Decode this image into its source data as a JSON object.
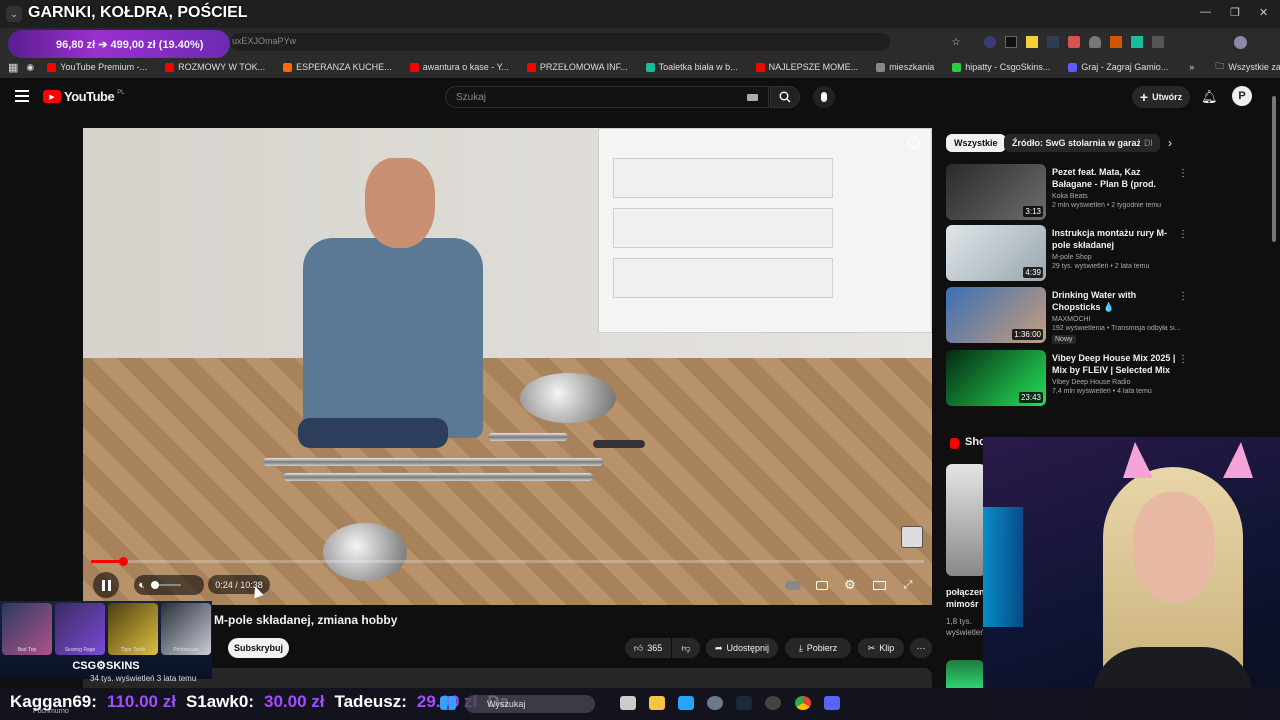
{
  "stream_overlay": {
    "title": "GARNKI, KOŁDRA, POŚCIEL",
    "price_text": "96,80 zł ➔ 499,00 zł (19.40%)",
    "url_fragment": "uxEXJOmaPYw"
  },
  "bookmarks": [
    {
      "label": "YouTube Premium -...",
      "color": "#ff0000"
    },
    {
      "label": "ROZMOWY W TOK...",
      "color": "#ff0000"
    },
    {
      "label": "ESPERANZA KUCHE...",
      "color": "#ff6a00"
    },
    {
      "label": "awantura o kase - Y...",
      "color": "#ff0000"
    },
    {
      "label": "PRZEŁOMOWA INF...",
      "color": "#ff0000"
    },
    {
      "label": "Toaletka biała w b...",
      "color": "#1abc9c"
    },
    {
      "label": "NAJLEPSZE MOME...",
      "color": "#ff0000"
    },
    {
      "label": "mieszkania",
      "color": "#888888"
    },
    {
      "label": "hipatty - CsgoSkins...",
      "color": "#2ecc40"
    },
    {
      "label": "Graj - Zagraj Gamio...",
      "color": "#5b5bff"
    }
  ],
  "bookmarks_all": "Wszystkie zakładki",
  "youtube": {
    "logo": "YouTube",
    "logo_country": "PL",
    "search_placeholder": "Szukaj",
    "create_label": "Utwórz"
  },
  "player": {
    "current_time": "0:24",
    "duration": "10:38",
    "time_display": "0:24 / 10:38",
    "progress": 0.038
  },
  "video": {
    "title": "M-pole składanej, zmiana hobby",
    "subscribe": "Subskrybuj",
    "likes": "365",
    "share": "Udostępnij",
    "download": "Pobierz",
    "clip": "Klip",
    "description_meta": "34 tys. wyświetleń  3 lata temu"
  },
  "chips": [
    {
      "label": "Wszystkie",
      "active": true
    },
    {
      "label": "Źródło: SwG stolarnia w garażu",
      "active": false
    },
    {
      "label": "Dl",
      "active": false
    }
  ],
  "recommendations": [
    {
      "title": "Pezet feat. Mata, Kaz Bałagane - Plan B (prod. Pedro, Frenkie G)",
      "channel": "Koka Beats",
      "meta": "2 mln wyświetleń • 2 tygodnie temu",
      "duration": "3:13",
      "badge": ""
    },
    {
      "title": "Instrukcja montażu rury M-pole składanej",
      "channel": "M-pole Shop",
      "meta": "29 tys. wyświetleń • 2 lata temu",
      "duration": "4:39",
      "badge": ""
    },
    {
      "title": "Drinking Water with Chopsticks 💧",
      "channel": "MAXMOCHI",
      "meta": "192 wyświetlenia • Transmisja odbyła si...",
      "duration": "1:36:00",
      "badge": "Nowy"
    },
    {
      "title": "Vibey Deep House Mix 2025 | Mix by FLEIV | Selected Mix ...",
      "channel": "Vibey Deep House Radio",
      "meta": "7,4 mln wyświetleń • 4 lata temu",
      "duration": "23:43",
      "badge": ""
    }
  ],
  "shorts": {
    "heading": "Sho",
    "title": "połączen mimośr",
    "meta": "1,8 tys. wyświetleń"
  },
  "csgo": {
    "brand": "CSG⚙SKINS",
    "skins": [
      "Bad Trip",
      "Searing Rage",
      "Tiger Tooth",
      "Printstream"
    ]
  },
  "ticker": [
    {
      "name": "Kaggan69:",
      "amount": "110.00 zł"
    },
    {
      "name": "S1awk0:",
      "amount": "30.00 zł"
    },
    {
      "name": "Tadeusz:",
      "amount": "29.00 zł"
    },
    {
      "name": "Da",
      "amount": ""
    }
  ],
  "taskbar": {
    "search_label": "Wyszukaj",
    "channel_label": "Pochmurno"
  }
}
